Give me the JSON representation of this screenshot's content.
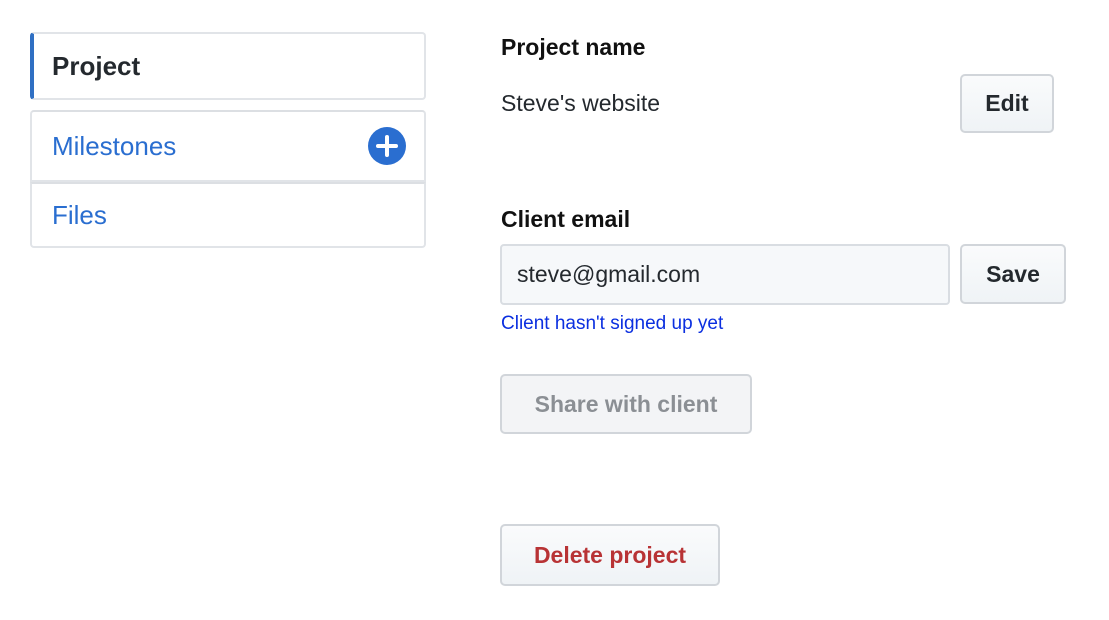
{
  "sidebar": {
    "items": [
      {
        "label": "Project"
      },
      {
        "label": "Milestones"
      },
      {
        "label": "Files"
      }
    ]
  },
  "project_name": {
    "label": "Project name",
    "value": "Steve's website",
    "edit_label": "Edit"
  },
  "client_email": {
    "label": "Client email",
    "value": "steve@gmail.com",
    "save_label": "Save",
    "hint": "Client hasn't signed up yet"
  },
  "share_label": "Share with client",
  "delete_label": "Delete project",
  "colors": {
    "accent": "#2a6ed0",
    "danger": "#b83335",
    "hint": "#0b2fe0"
  }
}
